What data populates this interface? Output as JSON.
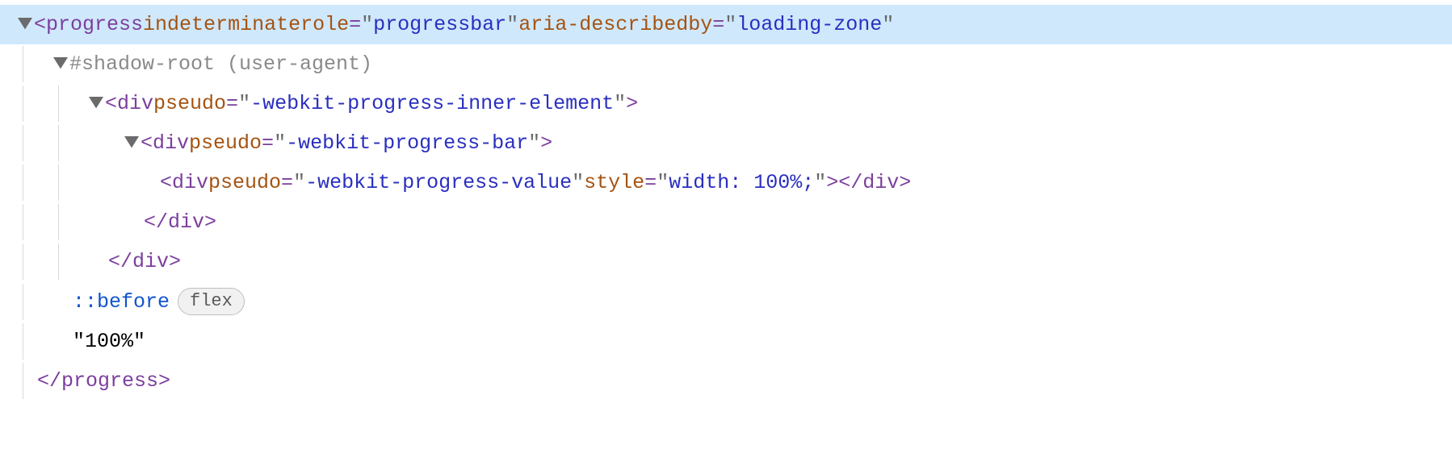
{
  "indent": {
    "base": 22,
    "step": 44,
    "arrowWidth": 24
  },
  "colors": {
    "selection": "#cfe8fc",
    "rule": "#d9d9d9"
  },
  "lines": [
    {
      "id": "l0",
      "depth": 0,
      "selected": true,
      "arrow": "down",
      "rules": [],
      "tokens": [
        {
          "t": "punct",
          "v": "<"
        },
        {
          "t": "tag",
          "v": "progress"
        },
        {
          "t": "space"
        },
        {
          "t": "attrn",
          "v": "indeterminate"
        },
        {
          "t": "space"
        },
        {
          "t": "attrn",
          "v": "role"
        },
        {
          "t": "punct",
          "v": "="
        },
        {
          "t": "quote",
          "v": "\""
        },
        {
          "t": "attrv",
          "v": "progressbar"
        },
        {
          "t": "quote",
          "v": "\""
        },
        {
          "t": "space"
        },
        {
          "t": "attrn",
          "v": "aria-describedby"
        },
        {
          "t": "punct",
          "v": "="
        },
        {
          "t": "quote",
          "v": "\""
        },
        {
          "t": "attrv",
          "v": "loading-zone"
        },
        {
          "t": "quote",
          "v": "\""
        }
      ]
    },
    {
      "id": "l1",
      "depth": 1,
      "arrow": "down",
      "rules": [
        0
      ],
      "tokens": [
        {
          "t": "shadow",
          "v": "#shadow-root (user-agent)"
        }
      ]
    },
    {
      "id": "l2",
      "depth": 2,
      "arrow": "down",
      "rules": [
        0,
        1
      ],
      "tokens": [
        {
          "t": "punct",
          "v": "<"
        },
        {
          "t": "tag",
          "v": "div"
        },
        {
          "t": "space"
        },
        {
          "t": "attrn",
          "v": "pseudo"
        },
        {
          "t": "punct",
          "v": "="
        },
        {
          "t": "quote",
          "v": "\""
        },
        {
          "t": "attrv",
          "v": "-webkit-progress-inner-element"
        },
        {
          "t": "quote",
          "v": "\""
        },
        {
          "t": "punct",
          "v": ">"
        }
      ]
    },
    {
      "id": "l3",
      "depth": 3,
      "arrow": "down",
      "rules": [
        0,
        1
      ],
      "tokens": [
        {
          "t": "punct",
          "v": "<"
        },
        {
          "t": "tag",
          "v": "div"
        },
        {
          "t": "space"
        },
        {
          "t": "attrn",
          "v": "pseudo"
        },
        {
          "t": "punct",
          "v": "="
        },
        {
          "t": "quote",
          "v": "\""
        },
        {
          "t": "attrv",
          "v": "-webkit-progress-bar"
        },
        {
          "t": "quote",
          "v": "\""
        },
        {
          "t": "punct",
          "v": ">"
        }
      ]
    },
    {
      "id": "l4",
      "depth": 4,
      "arrow": null,
      "rules": [
        0,
        1
      ],
      "tokens": [
        {
          "t": "punct",
          "v": "<"
        },
        {
          "t": "tag",
          "v": "div"
        },
        {
          "t": "space"
        },
        {
          "t": "attrn",
          "v": "pseudo"
        },
        {
          "t": "punct",
          "v": "="
        },
        {
          "t": "quote",
          "v": "\""
        },
        {
          "t": "attrv",
          "v": "-webkit-progress-value"
        },
        {
          "t": "quote",
          "v": "\""
        },
        {
          "t": "space"
        },
        {
          "t": "attrn",
          "v": "style"
        },
        {
          "t": "punct",
          "v": "="
        },
        {
          "t": "quote",
          "v": "\""
        },
        {
          "t": "attrv",
          "v": "width: 100%;"
        },
        {
          "t": "quote",
          "v": "\""
        },
        {
          "t": "punct",
          "v": ">"
        },
        {
          "t": "punct",
          "v": "</"
        },
        {
          "t": "tag",
          "v": "div"
        },
        {
          "t": "punct",
          "v": ">"
        }
      ]
    },
    {
      "id": "l5",
      "depth": 3,
      "arrow": null,
      "rules": [
        0,
        1
      ],
      "indentExtra": 24,
      "tokens": [
        {
          "t": "punct",
          "v": "</"
        },
        {
          "t": "tag",
          "v": "div"
        },
        {
          "t": "punct",
          "v": ">"
        }
      ]
    },
    {
      "id": "l6",
      "depth": 2,
      "arrow": null,
      "rules": [
        0,
        1
      ],
      "indentExtra": 24,
      "tokens": [
        {
          "t": "punct",
          "v": "</"
        },
        {
          "t": "tag",
          "v": "div"
        },
        {
          "t": "punct",
          "v": ">"
        }
      ]
    },
    {
      "id": "l7",
      "depth": 1,
      "arrow": null,
      "rules": [
        0
      ],
      "indentExtra": 24,
      "tokens": [
        {
          "t": "pseudo",
          "v": "::before"
        },
        {
          "t": "badge",
          "v": "flex"
        }
      ]
    },
    {
      "id": "l8",
      "depth": 1,
      "arrow": null,
      "rules": [
        0
      ],
      "indentExtra": 24,
      "tokens": [
        {
          "t": "text",
          "v": "\"100%\""
        }
      ]
    },
    {
      "id": "l9",
      "depth": 0,
      "arrow": null,
      "rules": [
        0
      ],
      "indentExtra": 24,
      "tokens": [
        {
          "t": "punct",
          "v": "</"
        },
        {
          "t": "tag",
          "v": "progress"
        },
        {
          "t": "punct",
          "v": ">"
        }
      ]
    }
  ]
}
